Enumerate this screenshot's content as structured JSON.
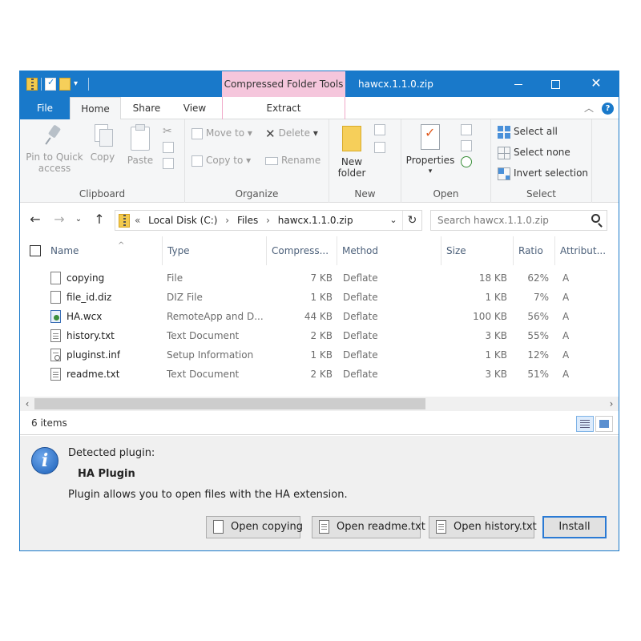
{
  "window": {
    "title": "hawcx.1.1.0.zip",
    "context_tab": "Compressed Folder Tools"
  },
  "ribbon_tabs": {
    "file": "File",
    "home": "Home",
    "share": "Share",
    "view": "View",
    "extract": "Extract"
  },
  "ribbon": {
    "clipboard": {
      "label": "Clipboard",
      "pin_to_quick_access": "Pin to Quick access",
      "copy": "Copy",
      "paste": "Paste"
    },
    "organize": {
      "label": "Organize",
      "move_to": "Move to",
      "copy_to": "Copy to",
      "delete": "Delete",
      "rename": "Rename"
    },
    "new": {
      "label": "New",
      "new_folder": "New folder"
    },
    "open": {
      "label": "Open",
      "properties": "Properties"
    },
    "select": {
      "label": "Select",
      "select_all": "Select all",
      "select_none": "Select none",
      "invert_selection": "Invert selection"
    }
  },
  "address": {
    "overflow": "«",
    "crumbs": [
      "Local Disk (C:)",
      "Files",
      "hawcx.1.1.0.zip"
    ],
    "search_placeholder": "Search hawcx.1.1.0.zip"
  },
  "columns": {
    "name": "Name",
    "type": "Type",
    "compressed": "Compress...",
    "method": "Method",
    "size": "Size",
    "ratio": "Ratio",
    "attributes": "Attribut..."
  },
  "files": [
    {
      "name": "copying",
      "type": "File",
      "compressed": "7 KB",
      "method": "Deflate",
      "size": "18 KB",
      "ratio": "62%",
      "attr": "A",
      "icon": "blank-file-icon"
    },
    {
      "name": "file_id.diz",
      "type": "DIZ File",
      "compressed": "1 KB",
      "method": "Deflate",
      "size": "1 KB",
      "ratio": "7%",
      "attr": "A",
      "icon": "blank-file-icon"
    },
    {
      "name": "HA.wcx",
      "type": "RemoteApp and D...",
      "compressed": "44 KB",
      "method": "Deflate",
      "size": "100 KB",
      "ratio": "56%",
      "attr": "A",
      "icon": "remoteapp-file-icon"
    },
    {
      "name": "history.txt",
      "type": "Text Document",
      "compressed": "2 KB",
      "method": "Deflate",
      "size": "3 KB",
      "ratio": "55%",
      "attr": "A",
      "icon": "text-file-icon"
    },
    {
      "name": "pluginst.inf",
      "type": "Setup Information",
      "compressed": "1 KB",
      "method": "Deflate",
      "size": "1 KB",
      "ratio": "12%",
      "attr": "A",
      "icon": "setup-file-icon"
    },
    {
      "name": "readme.txt",
      "type": "Text Document",
      "compressed": "2 KB",
      "method": "Deflate",
      "size": "3 KB",
      "ratio": "51%",
      "attr": "A",
      "icon": "text-file-icon"
    }
  ],
  "status": {
    "item_count": "6 items"
  },
  "plugin": {
    "detected_label": "Detected plugin:",
    "name": "HA Plugin",
    "description": "Plugin allows you to open files with the HA extension.",
    "buttons": {
      "open_copying": "Open copying",
      "open_readme": "Open readme.txt",
      "open_history": "Open history.txt",
      "install": "Install"
    }
  },
  "colors": {
    "titlebar": "#1979ca",
    "context_tab": "#f5c6dc",
    "ribbon_bg": "#f5f6f7",
    "panel_bg": "#f0f0f0"
  }
}
